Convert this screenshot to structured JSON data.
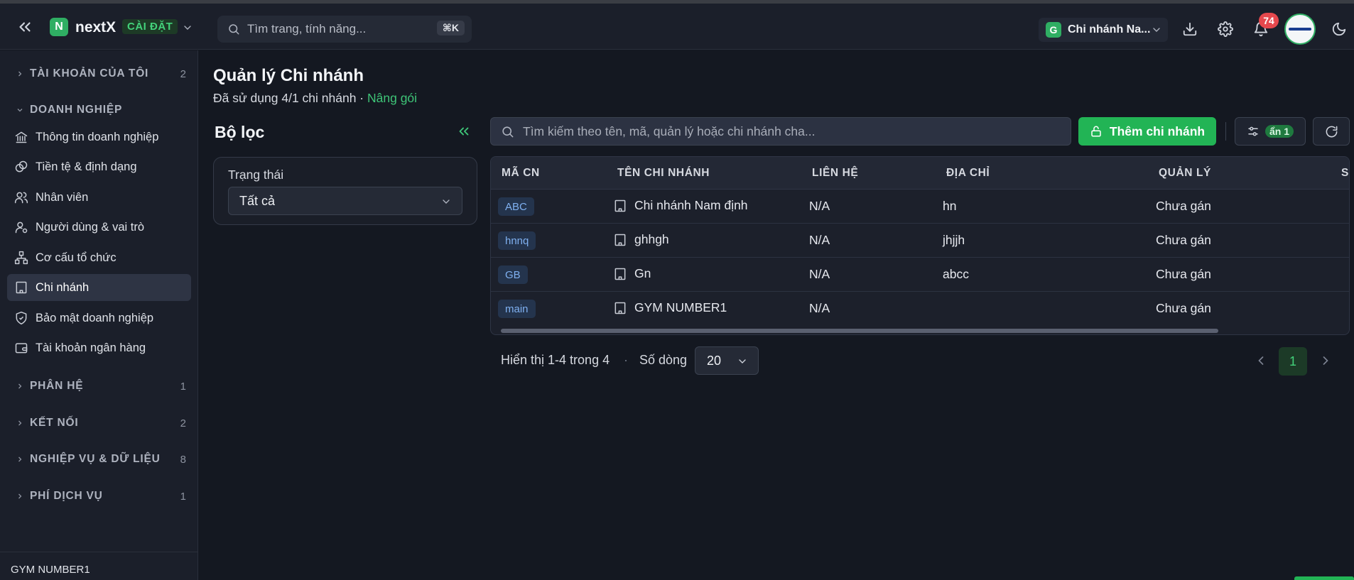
{
  "header": {
    "logo_letter": "N",
    "brand": "nextX",
    "env_badge": "CÀI ĐẶT",
    "search_placeholder": "Tìm trang, tính năng...",
    "search_shortcut": "⌘K",
    "branch_letter": "G",
    "branch_name": "Chi nhánh Na...",
    "notification_count": "74"
  },
  "sidebar": {
    "sections": [
      {
        "label": "TÀI KHOẢN CỦA TÔI",
        "count": "2",
        "expanded": false
      },
      {
        "label": "DOANH NGHIỆP",
        "count": "",
        "expanded": true
      },
      {
        "label": "PHÂN HỆ",
        "count": "1",
        "expanded": false
      },
      {
        "label": "KẾT NỐI",
        "count": "2",
        "expanded": false
      },
      {
        "label": "NGHIỆP VỤ & DỮ LIỆU",
        "count": "8",
        "expanded": false
      },
      {
        "label": "PHÍ DỊCH VỤ",
        "count": "1",
        "expanded": false
      }
    ],
    "items": [
      {
        "label": "Thông tin doanh nghiệp",
        "icon": "bank-icon"
      },
      {
        "label": "Tiền tệ & định dạng",
        "icon": "coins-icon"
      },
      {
        "label": "Nhân viên",
        "icon": "users-icon"
      },
      {
        "label": "Người dùng & vai trò",
        "icon": "user-cog-icon"
      },
      {
        "label": "Cơ cấu tổ chức",
        "icon": "network-icon"
      },
      {
        "label": "Chi nhánh",
        "icon": "building-icon",
        "active": true
      },
      {
        "label": "Bảo mật doanh nghiệp",
        "icon": "shield-icon"
      },
      {
        "label": "Tài khoản ngân hàng",
        "icon": "wallet-icon"
      }
    ],
    "footer": "GYM NUMBER1"
  },
  "page": {
    "title": "Quản lý Chi nhánh",
    "usage": "Đã sử dụng 4/1 chi nhánh · ",
    "upgrade": "Nâng gói"
  },
  "filter": {
    "title": "Bộ lọc",
    "status_label": "Trạng thái",
    "status_value": "Tất cả"
  },
  "toolbar": {
    "search_placeholder": "Tìm kiếm theo tên, mã, quản lý hoặc chi nhánh cha...",
    "add_label": "Thêm chi nhánh",
    "hidden_badge": "ẩn 1"
  },
  "table": {
    "columns": [
      "MÃ CN",
      "TÊN CHI NHÁNH",
      "LIÊN HỆ",
      "ĐỊA CHỈ",
      "QUẢN LÝ",
      "S"
    ],
    "rows": [
      {
        "code": "ABC",
        "name": "Chi nhánh Nam định",
        "contact": "N/A",
        "address": "hn",
        "manager": "Chưa gán"
      },
      {
        "code": "hnnq",
        "name": "ghhgh",
        "contact": "N/A",
        "address": "jhjjh",
        "manager": "Chưa gán"
      },
      {
        "code": "GB",
        "name": "Gn",
        "contact": "N/A",
        "address": "abcc",
        "manager": "Chưa gán"
      },
      {
        "code": "main",
        "name": "GYM NUMBER1",
        "contact": "N/A",
        "address": "",
        "manager": "Chưa gán"
      }
    ]
  },
  "pagination": {
    "info": "Hiển thị 1-4 trong 4",
    "separator": "·",
    "rows_label": "Số dòng",
    "rows_value": "20",
    "current_page": "1"
  },
  "colors": {
    "accent": "#22b455",
    "background": "#141821",
    "panel": "#1b1f2a",
    "badge_red": "#e5484d"
  }
}
